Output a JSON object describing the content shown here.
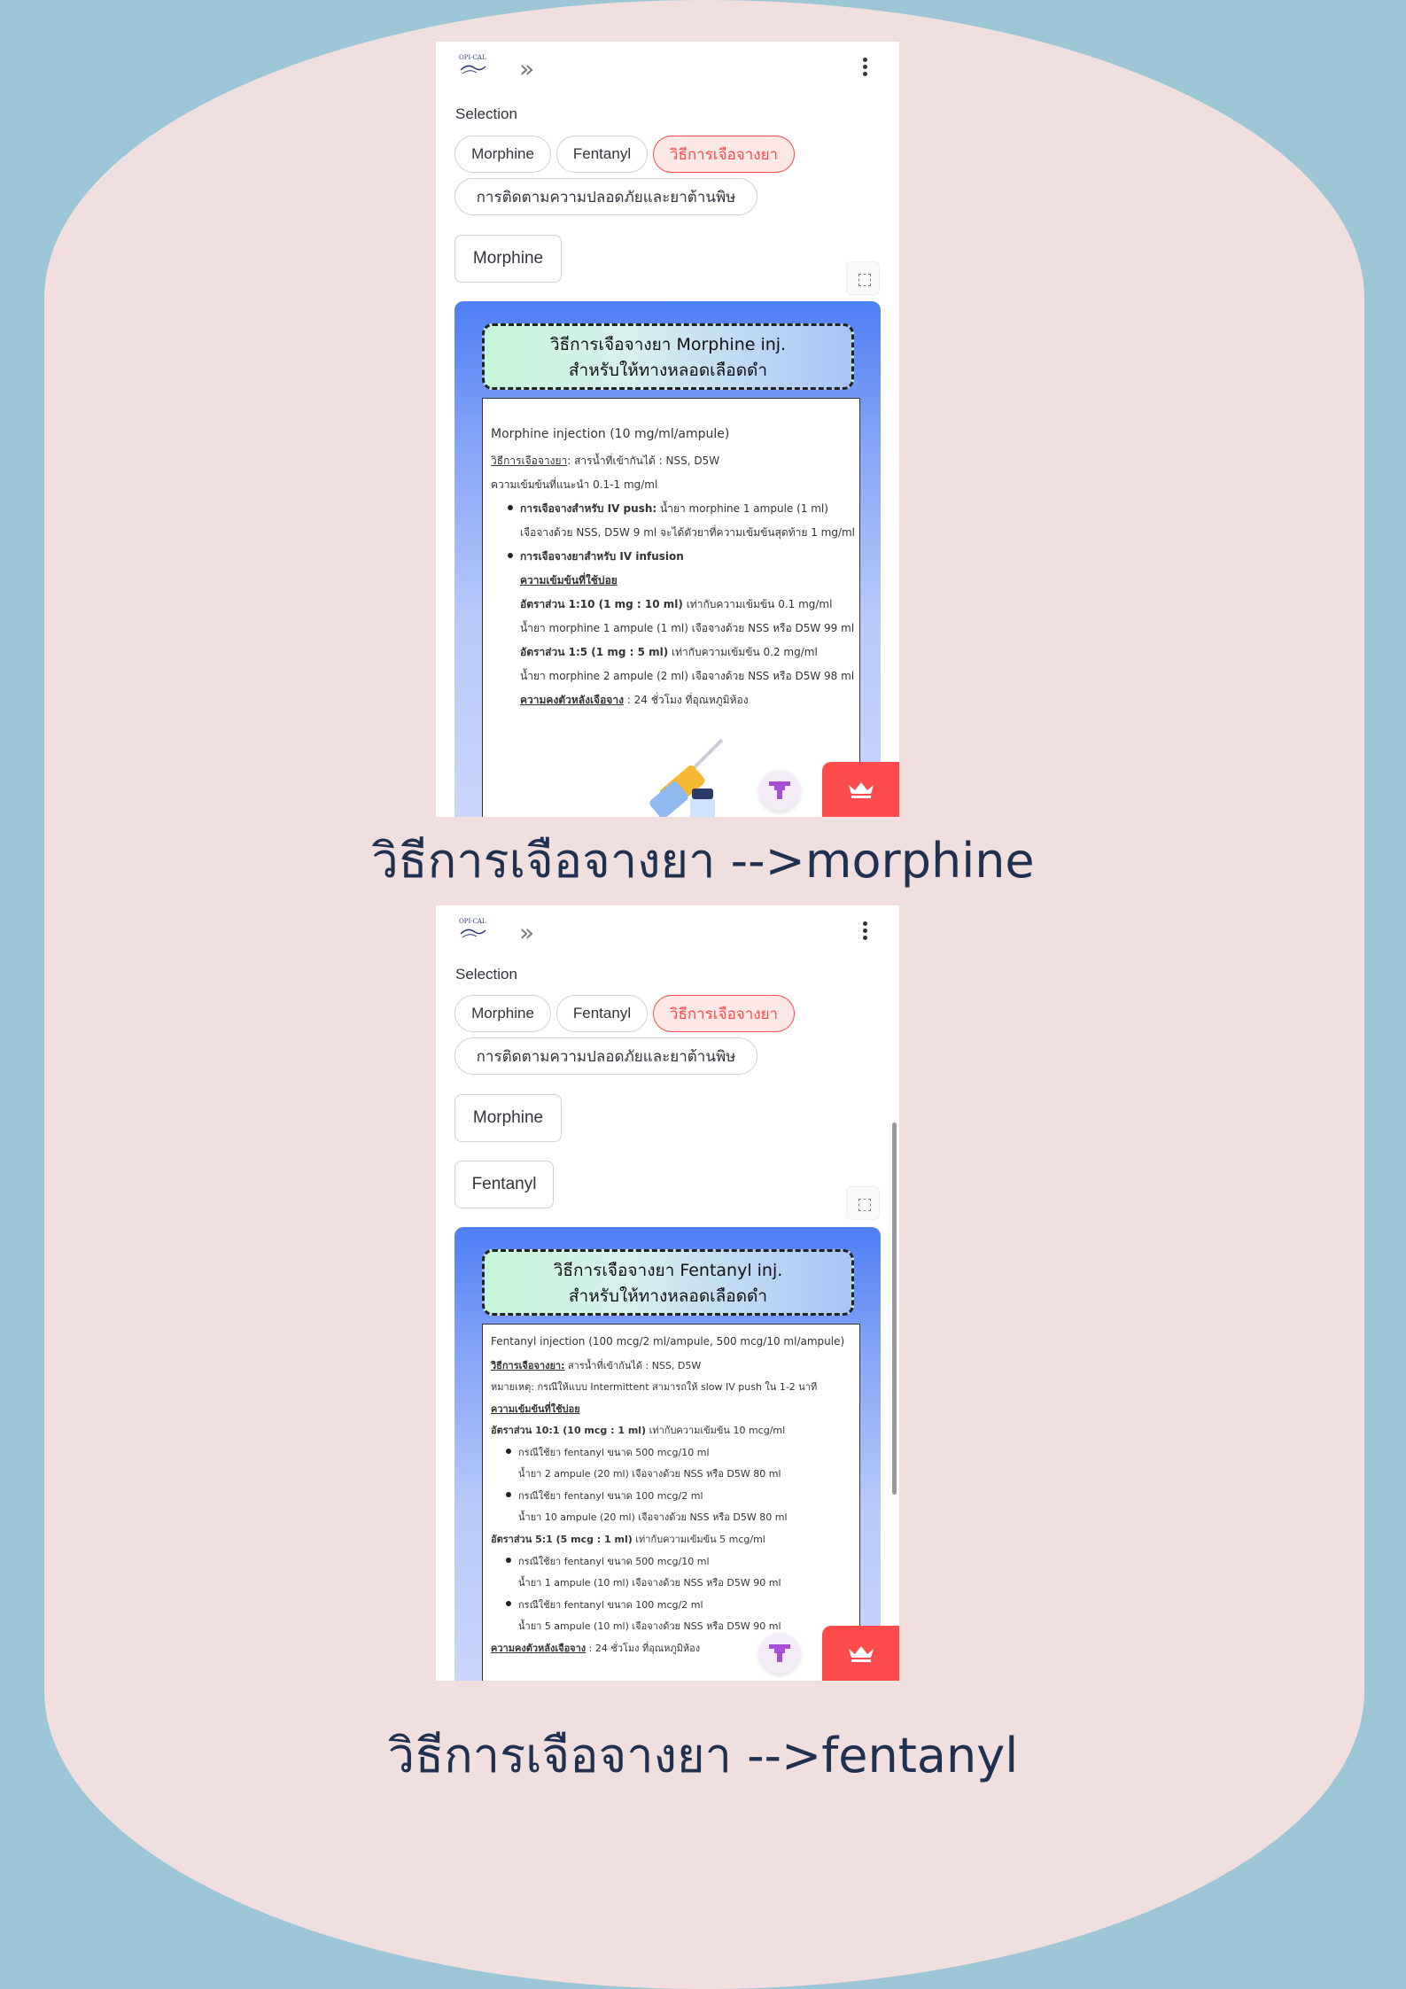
{
  "screens": [
    {
      "selection_label": "Selection",
      "pills": [
        "Morphine",
        "Fentanyl",
        "วิธีการเจือจางยา",
        "การติดตามความปลอดภัยและยาต้านพิษ"
      ],
      "buttons": [
        "Morphine"
      ],
      "card_title": [
        "วิธีการเจือจางยา Morphine inj.",
        "สำหรับให้ทางหลอดเลือดดำ"
      ],
      "caption": "วิธีการเจือจางยา -->morphine"
    },
    {
      "selection_label": "Selection",
      "pills": [
        "Morphine",
        "Fentanyl",
        "วิธีการเจือจางยา",
        "การติดตามความปลอดภัยและยาต้านพิษ"
      ],
      "buttons": [
        "Morphine",
        "Fentanyl"
      ],
      "card_title": [
        "วิธีการเจือจางยา Fentanyl inj.",
        "สำหรับให้ทางหลอดเลือดดำ"
      ],
      "caption": "วิธีการเจือจางยา -->fentanyl"
    }
  ],
  "morphine": {
    "heading": "Morphine injection (10 mg/ml/ampule)",
    "method_label": "วิธีการเจือจางยา",
    "method_text": ": สารน้ำที่เข้ากันได้ : NSS, D5W",
    "conc_line": "ความเข้มข้นที่แนะนำ 0.1-1 mg/ml",
    "iv_push_label": "การเจือจางสำหรับ IV push:",
    "iv_push_text": " น้ำยา morphine 1 ampule (1 ml)",
    "iv_push_text2": "เจือจางด้วย NSS, D5W 9 ml จะได้ตัวยาที่ความเข้มข้นสุดท้าย 1 mg/ml",
    "iv_inf_label": "การเจือจางยาสำหรับ IV infusion",
    "common_conc": "ความเข้มข้นที่ใช้บ่อย",
    "ratio1_label": "อัตราส่วน 1:10 (1 mg : 10 ml)",
    "ratio1_text": " เท่ากับความเข้มข้น 0.1 mg/ml",
    "ratio1_detail": "น้ำยา morphine 1 ampule (1 ml) เจือจางด้วย NSS หรือ D5W 99 ml",
    "ratio2_label": "อัตราส่วน 1:5 (1 mg : 5 ml)",
    "ratio2_text": " เท่ากับความเข้มข้น 0.2 mg/ml",
    "ratio2_detail": "น้ำยา morphine 2 ampule (2 ml) เจือจางด้วย NSS หรือ D5W 98 ml",
    "stability_label": "ความคงตัวหลังเจือจาง",
    "stability_text": " : 24 ชั่วโมง ที่อุณหภูมิห้อง"
  },
  "fentanyl": {
    "heading": "Fentanyl injection (100 mcg/2 ml/ampule, 500 mcg/10 ml/ampule)",
    "method_label": "วิธีการเจือจางยา:",
    "method_text": " สารน้ำที่เข้ากันได้ : NSS, D5W",
    "note": "หมายเหตุ: กรณีให้แบบ Intermittent สามารถให้ slow IV push ใน 1-2 นาที",
    "common_conc": "ความเข้มข้นที่ใช้บ่อย",
    "ratio1_label": "อัตราส่วน 10:1 (10 mcg : 1 ml)",
    "ratio1_text": " เท่ากับความเข้มข้น 10 mcg/ml",
    "r1_a": "กรณีใช้ยา fentanyl ขนาด 500 mcg/10 ml",
    "r1_a2": "น้ำยา 2 ampule (20 ml) เจือจางด้วย NSS หรือ D5W 80 ml",
    "r1_b": "กรณีใช้ยา fentanyl ขนาด 100 mcg/2 ml",
    "r1_b2": "น้ำยา 10 ampule (20 ml) เจือจางด้วย NSS หรือ D5W 80 ml",
    "ratio2_label": "อัตราส่วน 5:1 (5 mcg : 1 ml)",
    "ratio2_text": " เท่ากับความเข้มข้น 5 mcg/ml",
    "r2_a": "กรณีใช้ยา fentanyl ขนาด 500 mcg/10 ml",
    "r2_a2": "น้ำยา 1 ampule (10 ml) เจือจางด้วย NSS หรือ D5W 90 ml",
    "r2_b": "กรณีใช้ยา fentanyl ขนาด 100 mcg/2 ml",
    "r2_b2": "น้ำยา 5 ampule (10 ml) เจือจางด้วย NSS หรือ D5W 90 ml",
    "stability_label": "ความคงตัวหลังเจือจาง",
    "stability_text": " : 24 ชั่วโมง ที่อุณหภูมิห้อง"
  },
  "logo_text": "OPI-CAL",
  "icons": {
    "expand": "double-chevron-right-icon",
    "menu": "kebab-menu-icon",
    "fullscreen": "fullscreen-icon",
    "purple_fab": "streamlit-status-icon",
    "red_fab": "crown-icon"
  },
  "colors": {
    "accent": "#ff4b4b",
    "background_outer": "#9cc6d6",
    "background_inner": "#f1dfe0",
    "caption": "#1f3050"
  }
}
